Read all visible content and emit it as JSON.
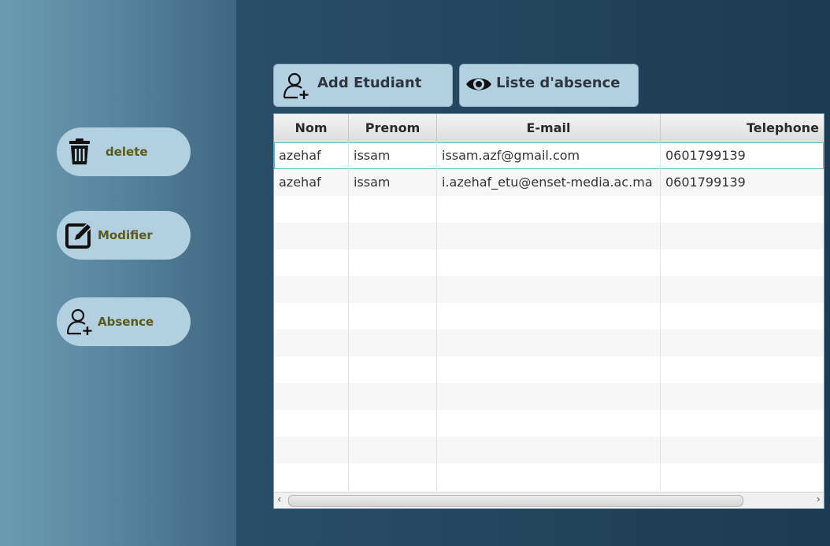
{
  "sidebar": {
    "delete_label": "delete",
    "modifier_label": "Modifier",
    "absence_label": "Absence"
  },
  "toolbar": {
    "add_label": "Add Etudiant",
    "liste_label": "Liste d'absence"
  },
  "table": {
    "columns": [
      "Nom",
      "Prenom",
      "E-mail",
      "Telephone"
    ],
    "rows": [
      [
        "azehaf",
        "issam",
        "issam.azf@gmail.com",
        "0601799139"
      ],
      [
        "azehaf",
        "issam",
        "i.azehaf_etu@enset-media.ac.ma",
        "0601799139"
      ]
    ]
  },
  "colors": {
    "button_bg": "#b3d0e0",
    "sidebar_label": "#5a5a1a",
    "selection_border": "#5fb7c2"
  },
  "icons": [
    "trash-icon",
    "edit-icon",
    "add-user-icon",
    "eye-icon"
  ]
}
